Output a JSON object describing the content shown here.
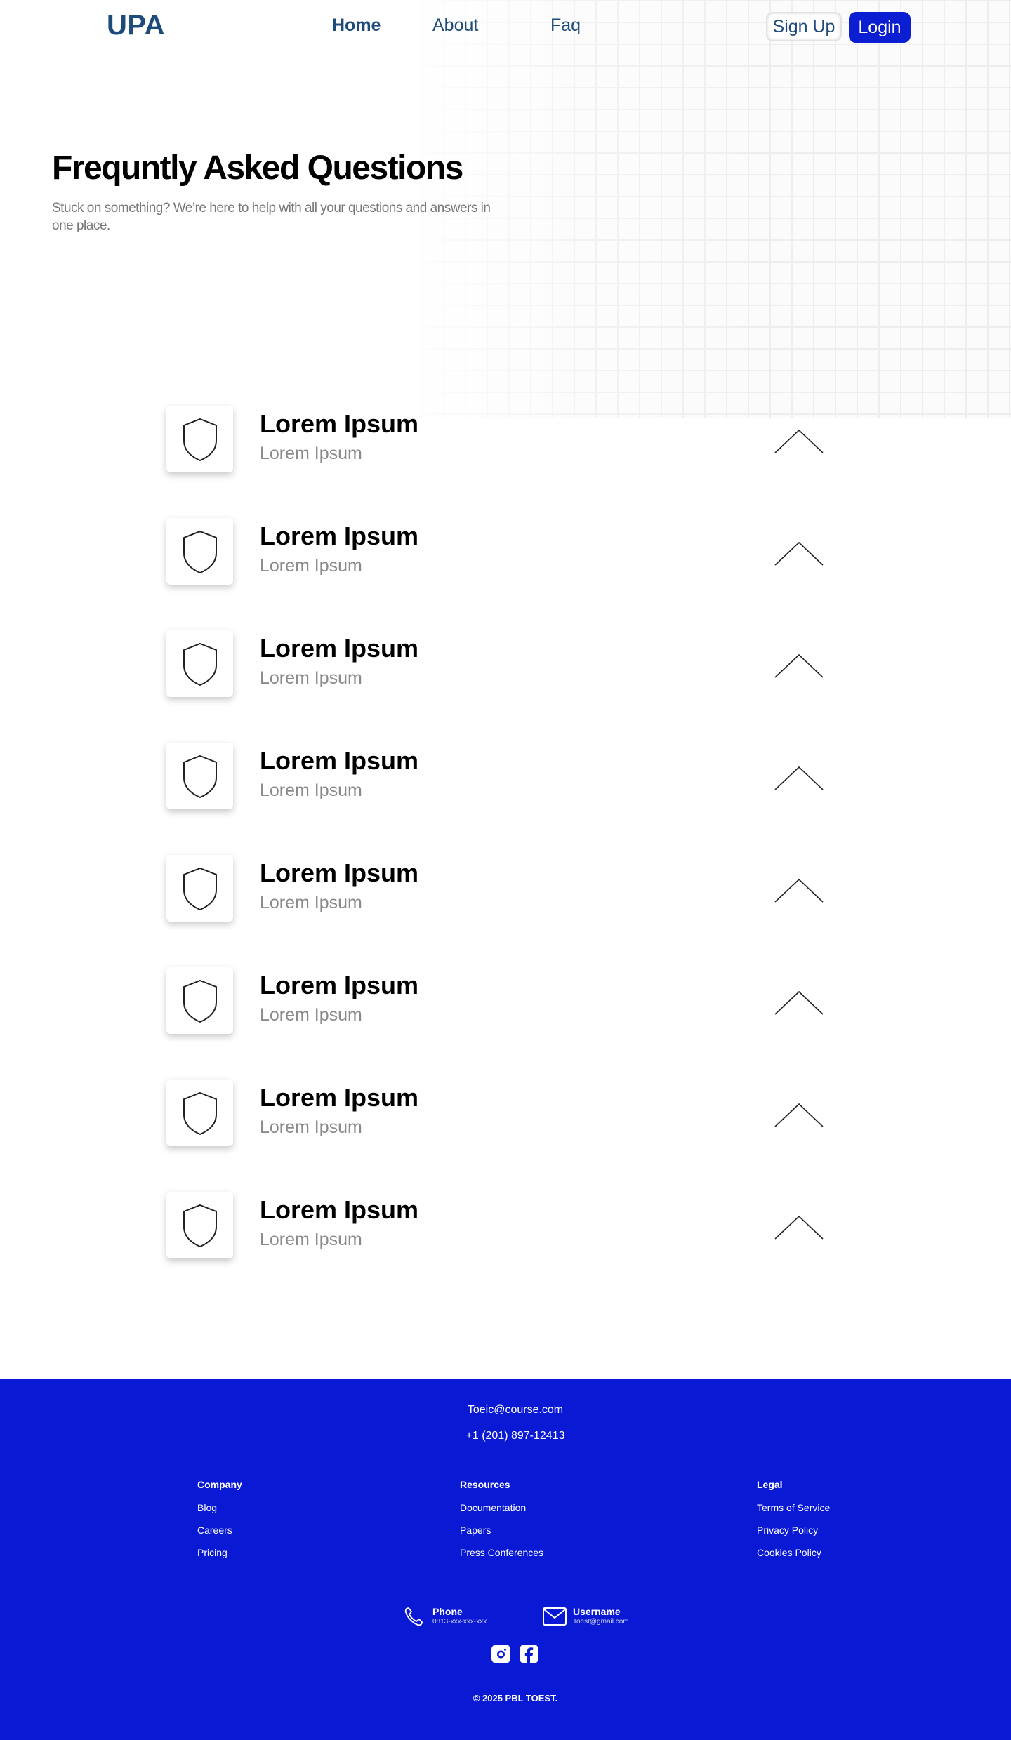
{
  "header": {
    "logo": "UPA",
    "nav": [
      {
        "label": "Home"
      },
      {
        "label": "About"
      },
      {
        "label": "Faq"
      }
    ],
    "signup_label": "Sign Up",
    "login_label": "Login"
  },
  "hero": {
    "title": "Frequntly Asked Questions",
    "subtitle": "Stuck on something? We’re here to help with all your questions and answers in one place."
  },
  "faq": {
    "items": [
      {
        "title": "Lorem Ipsum",
        "subtitle": "Lorem Ipsum",
        "icon": "shield-icon",
        "chevron": "chevron-up-icon"
      },
      {
        "title": "Lorem Ipsum",
        "subtitle": "Lorem Ipsum",
        "icon": "shield-icon",
        "chevron": "chevron-up-icon"
      },
      {
        "title": "Lorem Ipsum",
        "subtitle": "Lorem Ipsum",
        "icon": "shield-icon",
        "chevron": "chevron-up-icon"
      },
      {
        "title": "Lorem Ipsum",
        "subtitle": "Lorem Ipsum",
        "icon": "shield-icon",
        "chevron": "chevron-up-icon"
      },
      {
        "title": "Lorem Ipsum",
        "subtitle": "Lorem Ipsum",
        "icon": "shield-icon",
        "chevron": "chevron-up-icon"
      },
      {
        "title": "Lorem Ipsum",
        "subtitle": "Lorem Ipsum",
        "icon": "shield-icon",
        "chevron": "chevron-up-icon"
      },
      {
        "title": "Lorem Ipsum",
        "subtitle": "Lorem Ipsum",
        "icon": "shield-icon",
        "chevron": "chevron-up-icon"
      },
      {
        "title": "Lorem Ipsum",
        "subtitle": "Lorem Ipsum",
        "icon": "shield-icon",
        "chevron": "chevron-up-icon"
      }
    ]
  },
  "footer": {
    "email": "Toeic@course.com",
    "phone": "+1 (201) 897-12413",
    "columns": [
      {
        "heading": "Company",
        "links": [
          "Blog",
          "Careers",
          "Pricing"
        ]
      },
      {
        "heading": "Resources",
        "links": [
          "Documentation",
          "Papers",
          "Press Conferences"
        ]
      },
      {
        "heading": "Legal",
        "links": [
          "Terms of Service",
          "Privacy Policy",
          "Cookies Policy"
        ]
      }
    ],
    "contact_phone": {
      "label": "Phone",
      "value": "0813-xxx-xxx-xxx",
      "icon": "phone-icon"
    },
    "contact_user": {
      "label": "Username",
      "value": "Toest@gmail.com",
      "icon": "mail-icon"
    },
    "social": [
      "instagram-icon",
      "facebook-icon"
    ],
    "copyright": "© 2025 PBL TOEST."
  },
  "colors": {
    "brand_blue": "#0a19d3",
    "nav_text": "#1d4b7a",
    "login_bg": "#0b1ed1"
  }
}
